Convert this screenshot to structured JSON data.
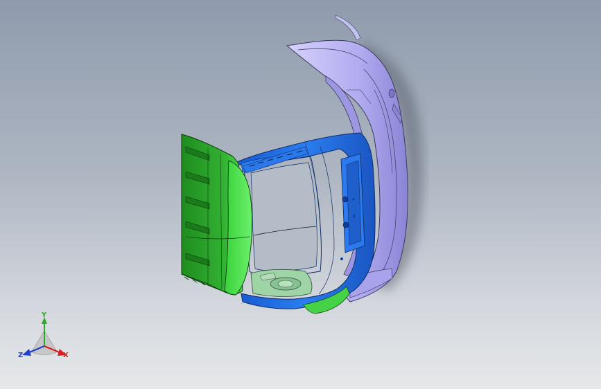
{
  "viewport": {
    "background_top": "#8f9bad",
    "background_bottom": "#e6e8ea"
  },
  "model": {
    "parts": [
      {
        "name": "rear-bumper-cover",
        "color": "#b3aef2"
      },
      {
        "name": "tailgate-inner-panel",
        "color": "#1f6fe0"
      },
      {
        "name": "tailgate-side-panel",
        "color": "#2ea82e"
      },
      {
        "name": "lower-garnish",
        "color": "#3ec43e"
      },
      {
        "name": "floor-pan",
        "color": "#8fcf9f"
      }
    ]
  },
  "triad": {
    "x_label": "X",
    "y_label": "Y",
    "z_label": "Z",
    "x_color": "#d42020",
    "y_color": "#2aa82a",
    "z_color": "#2040d0"
  }
}
